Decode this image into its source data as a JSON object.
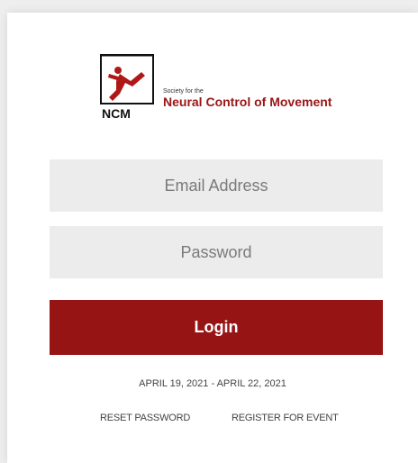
{
  "logo": {
    "mark_text": "NCM",
    "small_text": "Society for the",
    "big_text": "Neural Control of Movement",
    "brand_color": "#9a1515"
  },
  "form": {
    "email_placeholder": "Email Address",
    "password_placeholder": "Password",
    "login_label": "Login",
    "button_color": "#971414"
  },
  "event": {
    "dates": "APRIL 19, 2021  -  APRIL 22, 2021"
  },
  "links": {
    "reset_password": "RESET PASSWORD",
    "register": "REGISTER FOR EVENT"
  }
}
